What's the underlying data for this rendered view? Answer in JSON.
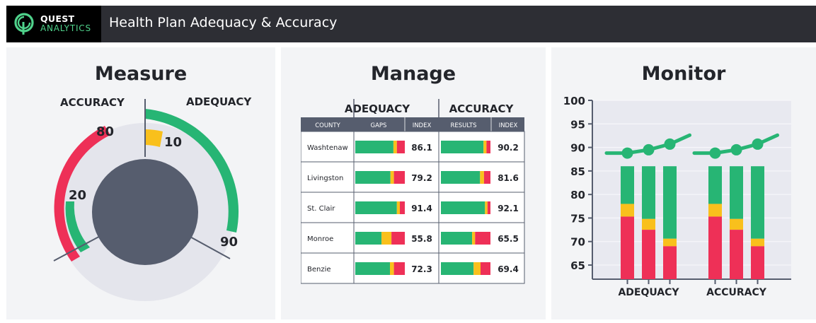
{
  "header": {
    "logo_line1": "QUEST",
    "logo_line2": "ANALYTICS",
    "title": "Health Plan Adequacy & Accuracy"
  },
  "colors": {
    "green": "#27b574",
    "red": "#ee3057",
    "yellow": "#f9c01c",
    "dark": "#565d6e",
    "header_bg": "#2d2e34"
  },
  "measure": {
    "title": "Measure",
    "left_label": "ACCURACY",
    "right_label": "ADEQUACY",
    "values": {
      "adequacy_outer": "90",
      "adequacy_inner": "10",
      "accuracy_outer": "80",
      "accuracy_inner": "20"
    }
  },
  "manage": {
    "title": "Manage",
    "group_headers": [
      "ADEQUACY",
      "ACCURACY"
    ],
    "columns": [
      "COUNTY",
      "GAPS",
      "INDEX",
      "RESULTS",
      "INDEX"
    ],
    "rows": [
      {
        "county": "Washtenaw",
        "adequacy_index": "86.1",
        "accuracy_index": "90.2",
        "gaps": [
          0.77,
          0.07,
          0.16
        ],
        "results": [
          0.86,
          0.06,
          0.08
        ]
      },
      {
        "county": "Livingston",
        "adequacy_index": "79.2",
        "accuracy_index": "81.6",
        "gaps": [
          0.71,
          0.07,
          0.22
        ],
        "results": [
          0.79,
          0.08,
          0.13
        ]
      },
      {
        "county": "St. Clair",
        "adequacy_index": "91.4",
        "accuracy_index": "92.1",
        "gaps": [
          0.84,
          0.06,
          0.1
        ],
        "results": [
          0.89,
          0.05,
          0.06
        ]
      },
      {
        "county": "Monroe",
        "adequacy_index": "55.8",
        "accuracy_index": "65.5",
        "gaps": [
          0.53,
          0.2,
          0.27
        ],
        "results": [
          0.63,
          0.06,
          0.31
        ]
      },
      {
        "county": "Benzie",
        "adequacy_index": "72.3",
        "accuracy_index": "69.4",
        "gaps": [
          0.7,
          0.08,
          0.22
        ],
        "results": [
          0.66,
          0.14,
          0.2
        ]
      }
    ]
  },
  "monitor": {
    "title": "Monitor",
    "chart_data": {
      "type": "bar",
      "title": "",
      "ylim": [
        62,
        100
      ],
      "yticks": [
        65,
        70,
        75,
        80,
        85,
        90,
        95,
        100
      ],
      "groups": [
        {
          "label": "ADEQUACY",
          "bars": [
            {
              "red": 75.3,
              "yellow": 78.0,
              "top": 86
            },
            {
              "red": 72.5,
              "yellow": 74.8,
              "top": 86
            },
            {
              "red": 69.0,
              "yellow": 70.6,
              "top": 86
            }
          ],
          "line": [
            88.8,
            89.5,
            90.7,
            92.6
          ]
        },
        {
          "label": "ACCURACY",
          "bars": [
            {
              "red": 75.3,
              "yellow": 78.0,
              "top": 86
            },
            {
              "red": 72.5,
              "yellow": 74.8,
              "top": 86
            },
            {
              "red": 69.0,
              "yellow": 70.6,
              "top": 86
            }
          ],
          "line": [
            88.8,
            89.5,
            90.7,
            92.6
          ]
        }
      ]
    }
  }
}
